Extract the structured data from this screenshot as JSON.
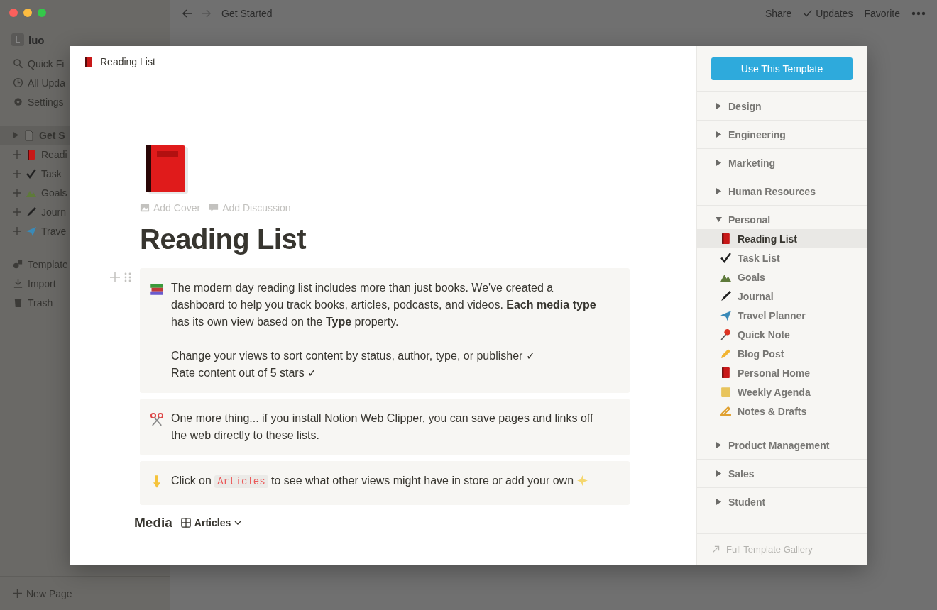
{
  "window": {
    "breadcrumb": "Get Started",
    "actions": [
      {
        "label": "Share",
        "kind": "plain"
      },
      {
        "label": "Updates",
        "kind": "check"
      },
      {
        "label": "Favorite",
        "kind": "plain"
      }
    ]
  },
  "sidebar": {
    "workspace": {
      "initial": "L",
      "name": "luo"
    },
    "nav": [
      {
        "label": "Quick Fi",
        "kind": "search"
      },
      {
        "label": "All Upda",
        "kind": "clock"
      },
      {
        "label": "Settings",
        "kind": "gear"
      }
    ],
    "pages": [
      {
        "label": "Get S",
        "kind": "doc",
        "selected": true
      },
      {
        "label": "Readi",
        "kind": "book",
        "selected": false
      },
      {
        "label": "Task",
        "kind": "check",
        "selected": false
      },
      {
        "label": "Goals",
        "kind": "mountain",
        "selected": false
      },
      {
        "label": "Journ",
        "kind": "pen",
        "selected": false
      },
      {
        "label": "Trave",
        "kind": "plane",
        "selected": false
      }
    ],
    "tools": [
      {
        "label": "Template",
        "kind": "shapes"
      },
      {
        "label": "Import",
        "kind": "download"
      },
      {
        "label": "Trash",
        "kind": "trash"
      }
    ],
    "new_page": "New Page"
  },
  "modal": {
    "breadcrumb": "Reading List",
    "add_cover": "Add Cover",
    "add_discussion": "Add Discussion",
    "title": "Reading List",
    "callouts": [
      {
        "kind": "books",
        "paragraphs": [
          [
            "The modern day reading list includes more than just books. We've created a dashboard to help you track books, articles, podcasts, and videos. **Each media type** has its own view based on the **Type** property."
          ],
          [
            "Change your views to sort content by status, author, type, or publisher ✓",
            "Rate content out of 5 stars ✓"
          ]
        ]
      },
      {
        "kind": "scissors",
        "before": "One more thing... if you install ",
        "link": "Notion Web Clipper",
        "after": ", you can save pages and links off the web directly to these lists."
      },
      {
        "kind": "pointer",
        "before": "Click on ",
        "code": "Articles",
        "after": " to see what other views might have in store or add your own"
      }
    ],
    "media": {
      "title": "Media",
      "view": "Articles"
    }
  },
  "templates": {
    "button": "Use This Template",
    "categories": [
      {
        "label": "Design",
        "expanded": false
      },
      {
        "label": "Engineering",
        "expanded": false
      },
      {
        "label": "Marketing",
        "expanded": false
      },
      {
        "label": "Human Resources",
        "expanded": false
      },
      {
        "label": "Personal",
        "expanded": true,
        "items": [
          {
            "label": "Reading List",
            "selected": true
          },
          {
            "label": "Task List",
            "selected": false
          },
          {
            "label": "Goals",
            "selected": false
          },
          {
            "label": "Journal",
            "selected": false
          },
          {
            "label": "Travel Planner",
            "selected": false
          },
          {
            "label": "Quick Note",
            "selected": false
          },
          {
            "label": "Blog Post",
            "selected": false
          },
          {
            "label": "Personal Home",
            "selected": false
          },
          {
            "label": "Weekly Agenda",
            "selected": false
          },
          {
            "label": "Notes & Drafts",
            "selected": false
          }
        ]
      },
      {
        "label": "Product Management",
        "expanded": false
      },
      {
        "label": "Sales",
        "expanded": false
      },
      {
        "label": "Student",
        "expanded": false
      }
    ],
    "gallery": "Full Template Gallery"
  }
}
